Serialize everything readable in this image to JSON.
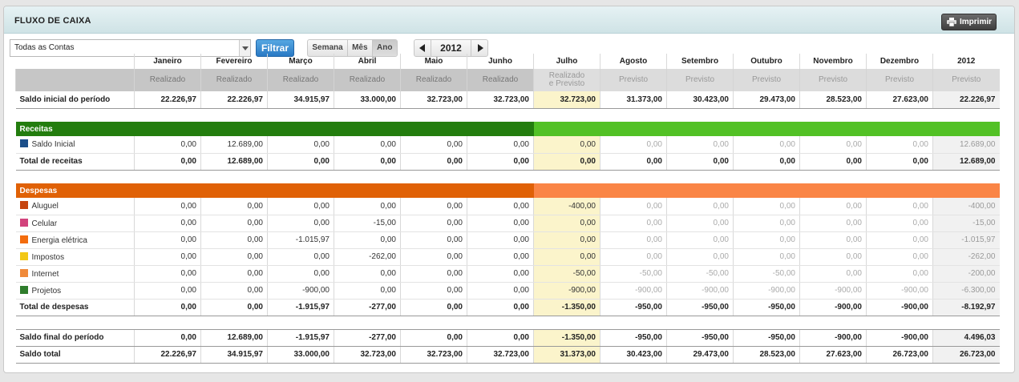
{
  "header": {
    "title": "FLUXO DE CAIXA",
    "print_label": "Imprimir"
  },
  "toolbar": {
    "account_select": "Todas as Contas",
    "filter_label": "Filtrar",
    "period": [
      "Semana",
      "Mês",
      "Ano"
    ],
    "period_selected": "Ano",
    "year": "2012"
  },
  "columns": [
    "Janeiro",
    "Fevereiro",
    "Março",
    "Abril",
    "Maio",
    "Junho",
    "Julho",
    "Agosto",
    "Setembro",
    "Outubro",
    "Novembro",
    "Dezembro",
    "2012"
  ],
  "status": [
    "Realizado",
    "Realizado",
    "Realizado",
    "Realizado",
    "Realizado",
    "Realizado",
    "Realizado e Previsto",
    "Previsto",
    "Previsto",
    "Previsto",
    "Previsto",
    "Previsto",
    "Previsto"
  ],
  "saldo_inicial": {
    "label": "Saldo inicial do período",
    "values": [
      "22.226,97",
      "22.226,97",
      "34.915,97",
      "33.000,00",
      "32.723,00",
      "32.723,00",
      "32.723,00",
      "31.373,00",
      "30.423,00",
      "29.473,00",
      "28.523,00",
      "27.623,00",
      "22.226,97"
    ]
  },
  "receitas": {
    "title": "Receitas",
    "colors": {
      "dark": "#237d0e",
      "light": "#52c125"
    },
    "rows": [
      {
        "label": "Saldo Inicial",
        "color": "#1c4f8a",
        "values": [
          "0,00",
          "12.689,00",
          "0,00",
          "0,00",
          "0,00",
          "0,00",
          "0,00",
          "0,00",
          "0,00",
          "0,00",
          "0,00",
          "0,00",
          "12.689,00"
        ]
      }
    ],
    "total": {
      "label": "Total de receitas",
      "values": [
        "0,00",
        "12.689,00",
        "0,00",
        "0,00",
        "0,00",
        "0,00",
        "0,00",
        "0,00",
        "0,00",
        "0,00",
        "0,00",
        "0,00",
        "12.689,00"
      ]
    }
  },
  "despesas": {
    "title": "Despesas",
    "colors": {
      "dark": "#e06106",
      "light": "#fa8546"
    },
    "rows": [
      {
        "label": "Aluguel",
        "color": "#c6440f",
        "values": [
          "0,00",
          "0,00",
          "0,00",
          "0,00",
          "0,00",
          "0,00",
          "-400,00",
          "0,00",
          "0,00",
          "0,00",
          "0,00",
          "0,00",
          "-400,00"
        ]
      },
      {
        "label": "Celular",
        "color": "#d2437c",
        "values": [
          "0,00",
          "0,00",
          "0,00",
          "-15,00",
          "0,00",
          "0,00",
          "0,00",
          "0,00",
          "0,00",
          "0,00",
          "0,00",
          "0,00",
          "-15,00"
        ]
      },
      {
        "label": "Energia elétrica",
        "color": "#f36c0d",
        "values": [
          "0,00",
          "0,00",
          "-1.015,97",
          "0,00",
          "0,00",
          "0,00",
          "0,00",
          "0,00",
          "0,00",
          "0,00",
          "0,00",
          "0,00",
          "-1.015,97"
        ]
      },
      {
        "label": "Impostos",
        "color": "#f2c715",
        "values": [
          "0,00",
          "0,00",
          "0,00",
          "-262,00",
          "0,00",
          "0,00",
          "0,00",
          "0,00",
          "0,00",
          "0,00",
          "0,00",
          "0,00",
          "-262,00"
        ]
      },
      {
        "label": "Internet",
        "color": "#f08a3a",
        "values": [
          "0,00",
          "0,00",
          "0,00",
          "0,00",
          "0,00",
          "0,00",
          "-50,00",
          "-50,00",
          "-50,00",
          "-50,00",
          "0,00",
          "0,00",
          "-200,00"
        ]
      },
      {
        "label": "Projetos",
        "color": "#2f7d2c",
        "values": [
          "0,00",
          "0,00",
          "-900,00",
          "0,00",
          "0,00",
          "0,00",
          "-900,00",
          "-900,00",
          "-900,00",
          "-900,00",
          "-900,00",
          "-900,00",
          "-6.300,00"
        ]
      }
    ],
    "total": {
      "label": "Total de despesas",
      "values": [
        "0,00",
        "0,00",
        "-1.915,97",
        "-277,00",
        "0,00",
        "0,00",
        "-1.350,00",
        "-950,00",
        "-950,00",
        "-950,00",
        "-900,00",
        "-900,00",
        "-8.192,97"
      ]
    }
  },
  "saldo_final": {
    "label": "Saldo final do período",
    "values": [
      "0,00",
      "12.689,00",
      "-1.915,97",
      "-277,00",
      "0,00",
      "0,00",
      "-1.350,00",
      "-950,00",
      "-950,00",
      "-950,00",
      "-900,00",
      "-900,00",
      "4.496,03"
    ]
  },
  "saldo_total": {
    "label": "Saldo total",
    "values": [
      "22.226,97",
      "34.915,97",
      "33.000,00",
      "32.723,00",
      "32.723,00",
      "32.723,00",
      "31.373,00",
      "30.423,00",
      "29.473,00",
      "28.523,00",
      "27.623,00",
      "26.723,00",
      "26.723,00"
    ]
  }
}
